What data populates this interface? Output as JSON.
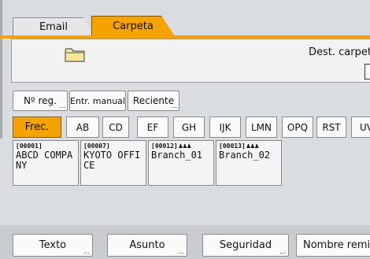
{
  "tabs": [
    {
      "label": "Email",
      "active": false
    },
    {
      "label": "Carpeta",
      "active": true
    }
  ],
  "destination": {
    "label": "Dest. carpeta",
    "icon": "folder-icon"
  },
  "actions": {
    "reg_label": "Nº reg.",
    "manual_label": "Entr. manual",
    "reciente_label": "Reciente"
  },
  "filters": [
    {
      "label": "Frec.",
      "active": true
    },
    {
      "label": "AB"
    },
    {
      "label": "CD"
    },
    {
      "label": "EF"
    },
    {
      "label": "GH"
    },
    {
      "label": "IJK"
    },
    {
      "label": "LMN"
    },
    {
      "label": "OPQ"
    },
    {
      "label": "RST"
    },
    {
      "label": "UV"
    }
  ],
  "entries": [
    {
      "id": "[00001]",
      "name": "ABCD COMPANY",
      "group": false
    },
    {
      "id": "[00007]",
      "name": "KYOTO OFFICE",
      "group": false
    },
    {
      "id": "[00012]",
      "name": "Branch_01",
      "group": true
    },
    {
      "id": "[00013]",
      "name": "Branch_02",
      "group": true
    }
  ],
  "bottom": {
    "texto_label": "Texto",
    "asunto_label": "Asunto",
    "seguridad_label": "Seguridad",
    "remitente_label": "Nombre remitente"
  },
  "colors": {
    "accent": "#f5a300",
    "panel": "#f2f2f2",
    "background": "#d9dde1"
  }
}
